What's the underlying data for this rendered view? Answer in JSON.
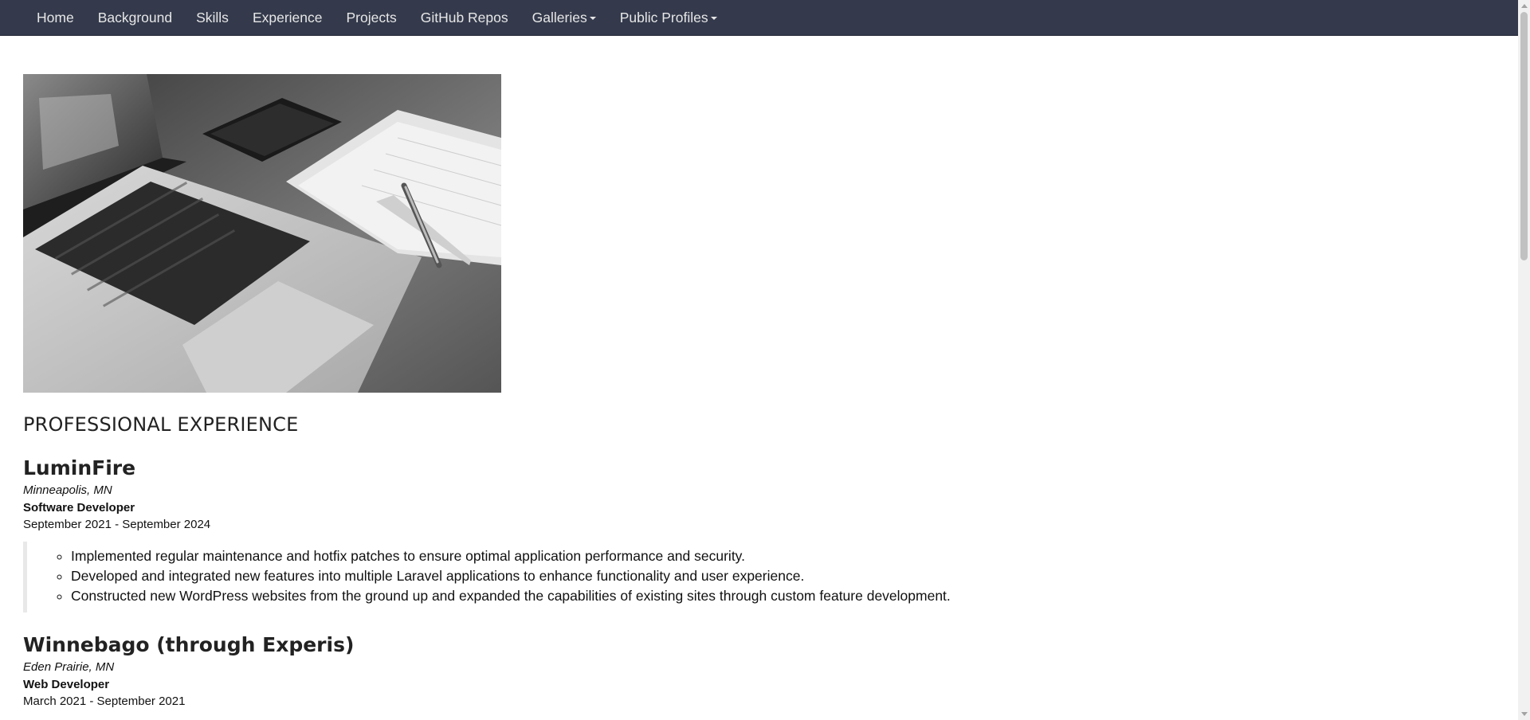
{
  "nav": {
    "items": [
      {
        "label": "Home"
      },
      {
        "label": "Background"
      },
      {
        "label": "Skills"
      },
      {
        "label": "Experience"
      },
      {
        "label": "Projects"
      },
      {
        "label": "GitHub Repos"
      },
      {
        "label": "Galleries",
        "dropdown": true
      },
      {
        "label": "Public Profiles",
        "dropdown": true
      }
    ]
  },
  "hero": {
    "icon": "laptop-desk-photo"
  },
  "section": {
    "title": "PROFESSIONAL EXPERIENCE"
  },
  "jobs": [
    {
      "company": "LuminFire",
      "location": "Minneapolis, MN",
      "role": "Software Developer",
      "dates": "September 2021 - September 2024",
      "duties": [
        "Implemented regular maintenance and hotfix patches to ensure optimal application performance and security.",
        "Developed and integrated new features into multiple Laravel applications to enhance functionality and user experience.",
        "Constructed new WordPress websites from the ground up and expanded the capabilities of existing sites through custom feature development."
      ]
    },
    {
      "company": "Winnebago (through Experis)",
      "location": "Eden Prairie, MN",
      "role": "Web Developer",
      "dates": "March 2021 - September 2021"
    }
  ]
}
